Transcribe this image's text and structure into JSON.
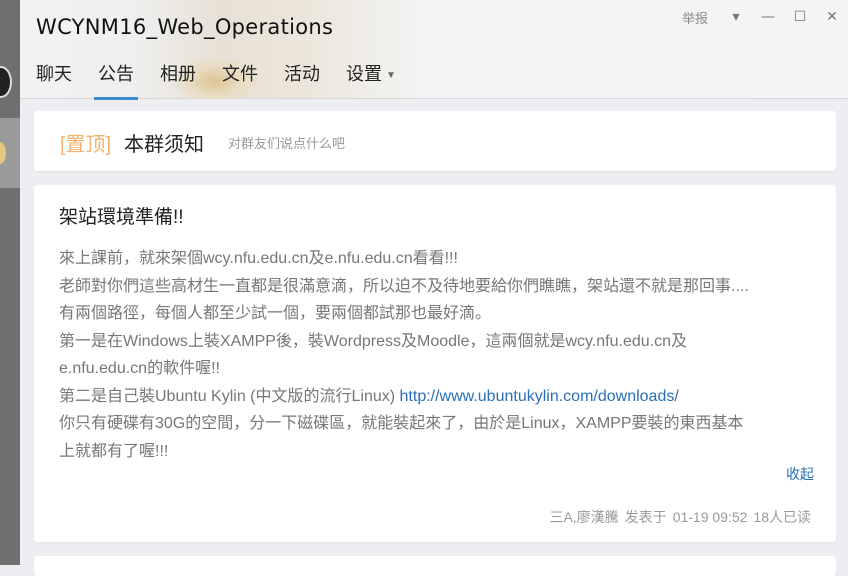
{
  "window": {
    "title": "WCYNM16_Web_Operations",
    "report_label": "举报",
    "dropdown_glyph": "▾",
    "minimize_glyph": "—",
    "maximize_glyph": "☐",
    "close_glyph": "✕"
  },
  "tabs": [
    {
      "label": "聊天"
    },
    {
      "label": "公告"
    },
    {
      "label": "相册"
    },
    {
      "label": "文件"
    },
    {
      "label": "活动"
    },
    {
      "label": "设置"
    }
  ],
  "notice_bar": {
    "pin_label": "[置顶]",
    "title": "本群须知",
    "tip": "对群友们说点什么吧"
  },
  "post": {
    "title": "架站環境準備!!",
    "lines": [
      "來上課前，就來架個wcy.nfu.edu.cn及e.nfu.edu.cn看看!!!",
      "老師對你們這些高材生一直都是很滿意滴，所以迫不及待地要給你們瞧瞧，架站還不就是那回事....",
      "有兩個路徑，每個人都至少試一個，要兩個都試那也最好滴。",
      "第一是在Windows上裝XAMPP後，裝Wordpress及Moodle，這兩個就是wcy.nfu.edu.cn及",
      "e.nfu.edu.cn的軟件喔!!"
    ],
    "line6_prefix": "第二是自己裝Ubuntu Kylin (中文版的流行Linux) ",
    "link_text": "http://www.ubuntukylin.com/downloads/",
    "lines_after": [
      "你只有硬碟有30G的空間，分一下磁碟區，就能裝起來了，由於是Linux，XAMPP要裝的東西基本",
      "上就都有了喔!!!"
    ],
    "collapse_label": "收起",
    "author": "三A,廖漢騰",
    "posted_label": "发表于",
    "datetime": "01-19 09:52",
    "read_count": "18人已读"
  },
  "colors": {
    "accent": "#3c8ccf",
    "link": "#2a6fb8",
    "pin": "#f0b26c"
  }
}
